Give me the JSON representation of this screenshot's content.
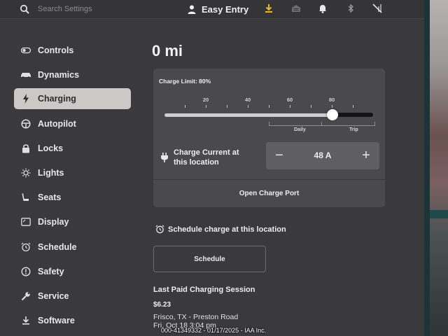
{
  "search": {
    "placeholder": "Search Settings"
  },
  "profile": {
    "name": "Easy Entry"
  },
  "top_icons": [
    "download-icon",
    "garage-icon",
    "bell-icon",
    "bluetooth-icon",
    "no-signal-icon"
  ],
  "sidebar": {
    "items": [
      {
        "label": "Controls",
        "icon": "toggle-icon"
      },
      {
        "label": "Dynamics",
        "icon": "car-icon"
      },
      {
        "label": "Charging",
        "icon": "lightning-icon",
        "active": true
      },
      {
        "label": "Autopilot",
        "icon": "steering-wheel-icon"
      },
      {
        "label": "Locks",
        "icon": "lock-icon"
      },
      {
        "label": "Lights",
        "icon": "sun-icon"
      },
      {
        "label": "Seats",
        "icon": "seat-icon"
      },
      {
        "label": "Display",
        "icon": "display-icon"
      },
      {
        "label": "Schedule",
        "icon": "alarm-clock-icon"
      },
      {
        "label": "Safety",
        "icon": "info-circle-icon"
      },
      {
        "label": "Service",
        "icon": "wrench-icon"
      },
      {
        "label": "Software",
        "icon": "download-icon"
      }
    ]
  },
  "charging": {
    "range": "0 mi",
    "limit_label": "Charge Limit: 80%",
    "limit_percent": 80,
    "tick_labels": [
      "20",
      "40",
      "60",
      "80"
    ],
    "range_labels": {
      "daily": "Daily",
      "trip": "Trip"
    },
    "current_label": "Charge Current at this location",
    "current_value": "48 A",
    "minus": "−",
    "plus": "+",
    "open_port": "Open Charge Port",
    "schedule_label": "Schedule charge at this location",
    "schedule_button": "Schedule",
    "last_session": {
      "title": "Last Paid Charging Session",
      "amount": "$6.23",
      "location": "Frisco, TX - Preston Road",
      "date": "Fri, Oct 18 3:04 pm"
    }
  },
  "watermark": "000-41349332 - 01/17/2025 - IAA Inc.",
  "colors": {
    "active_bg": "#cbc8c8",
    "card_bg": "#4a494c",
    "screen_bg": "#3a393b"
  }
}
